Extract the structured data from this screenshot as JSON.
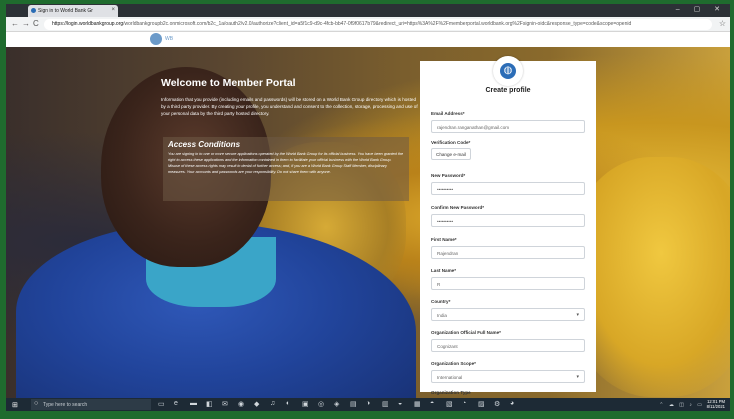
{
  "browser": {
    "tab_title": "Sign in to World Bank Gr",
    "tab_close": "×",
    "window_controls": "–  ▢  ✕",
    "url_host": "https://login.worldbankgroup.org",
    "url_rest": "/worldbankgroupb2c.onmicrosoft.com/b2c_1a/oauth2/v2.0/authorize?client_id=a5f1c9-d9c-4fcb-bb47-0f9f0617b79&redirect_uri=https%3A%2F%2Fmemberportal.worldbank.org%2Fsignin-oidc&response_type=code&scope=openid",
    "back_icon": "←",
    "forward_icon": "→",
    "reload_icon": "C",
    "lock_icon": "🔒",
    "star_icon": "☆"
  },
  "site": {
    "logo_text": "WB"
  },
  "hero": {
    "title": "Welcome to Member Portal",
    "intro": "Information that you provide (including emails and passwords) will be stored on a World Bank Group directory which is hosted by a third party provider. By creating your profile, you understand and consent to the collection, storage, processing and use of your personal data by the third party hosted directory.",
    "access_title": "Access Conditions",
    "access_text": "You are signing in to one or more secure applications operated by the World Bank Group for its official business. You have been granted the right to access these applications and the information contained in them to facilitate your official business with the World Bank Group. Misuse of these access rights may result in denial of further access; and, if you are a World Bank Group Staff Member, disciplinary measures. Your accounts and passwords are your responsibility. Do not share them with anyone."
  },
  "form": {
    "title": "Create profile",
    "email_label": "Email Address*",
    "email_value": "rajendran.ranganathan@gmail.com",
    "verification_label": "Verification Code*",
    "change_email_button": "Change e-mail",
    "new_password_label": "New Password*",
    "new_password_value": "••••••••••",
    "confirm_password_label": "Confirm New Password*",
    "confirm_password_value": "••••••••••",
    "first_name_label": "First Name*",
    "first_name_value": "Rajendran",
    "last_name_label": "Last Name*",
    "last_name_value": "R",
    "country_label": "Country*",
    "country_value": "India",
    "org_name_label": "Organization Official Full Name*",
    "org_name_value": "Cognizant",
    "org_scope_label": "Organization Scope*",
    "org_scope_value": "International",
    "org_type_label": "Organization Type",
    "caret": "▾"
  },
  "taskbar": {
    "start_icon": "⊞",
    "search_icon": "○",
    "search_placeholder": "Type here to search",
    "tray_icons": "⌃ ☁ ◫ ♪ ▭",
    "time": "12:01 PM",
    "date": "8/11/2021"
  }
}
